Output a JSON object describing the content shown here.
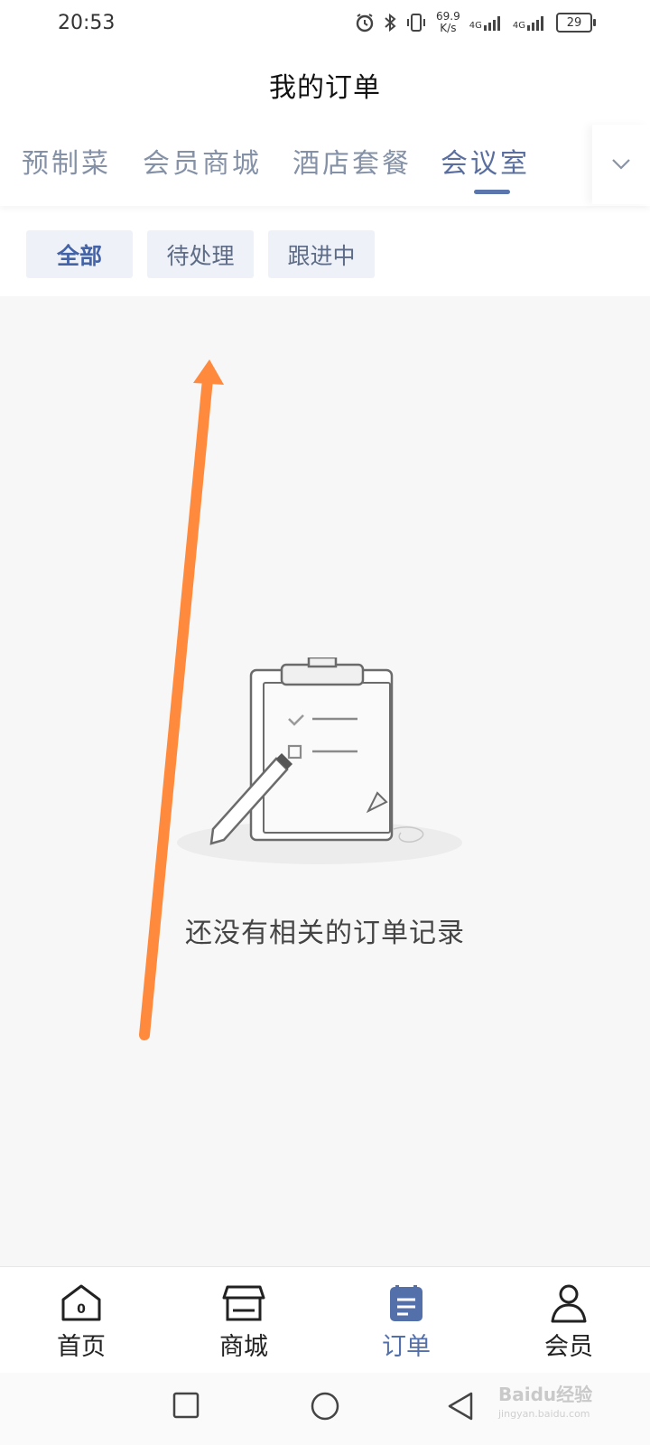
{
  "status": {
    "time": "20:53",
    "net_speed_value": "69.9",
    "net_speed_unit": "K/s",
    "signal1_label": "4G",
    "signal2_label": "4G",
    "battery": "29"
  },
  "header": {
    "title": "我的订单"
  },
  "tabs": [
    {
      "label": "预制菜"
    },
    {
      "label": "会员商城"
    },
    {
      "label": "酒店套餐"
    },
    {
      "label": "会议室"
    }
  ],
  "filters": [
    {
      "label": "全部"
    },
    {
      "label": "待处理"
    },
    {
      "label": "跟进中"
    }
  ],
  "empty_state": {
    "message": "还没有相关的订单记录"
  },
  "bottom_nav": [
    {
      "label": "首页",
      "icon": "home-icon",
      "badge": "0"
    },
    {
      "label": "商城",
      "icon": "store-icon"
    },
    {
      "label": "订单",
      "icon": "order-icon"
    },
    {
      "label": "会员",
      "icon": "member-icon"
    }
  ],
  "watermark": {
    "brand": "Baidu经验",
    "url": "jingyan.baidu.com"
  },
  "colors": {
    "accent": "#5470ab",
    "tab_inactive": "#8491a6",
    "chip_bg": "#eef2f8",
    "content_bg": "#f7f7f7",
    "annotation_arrow": "#ff8a3d"
  }
}
